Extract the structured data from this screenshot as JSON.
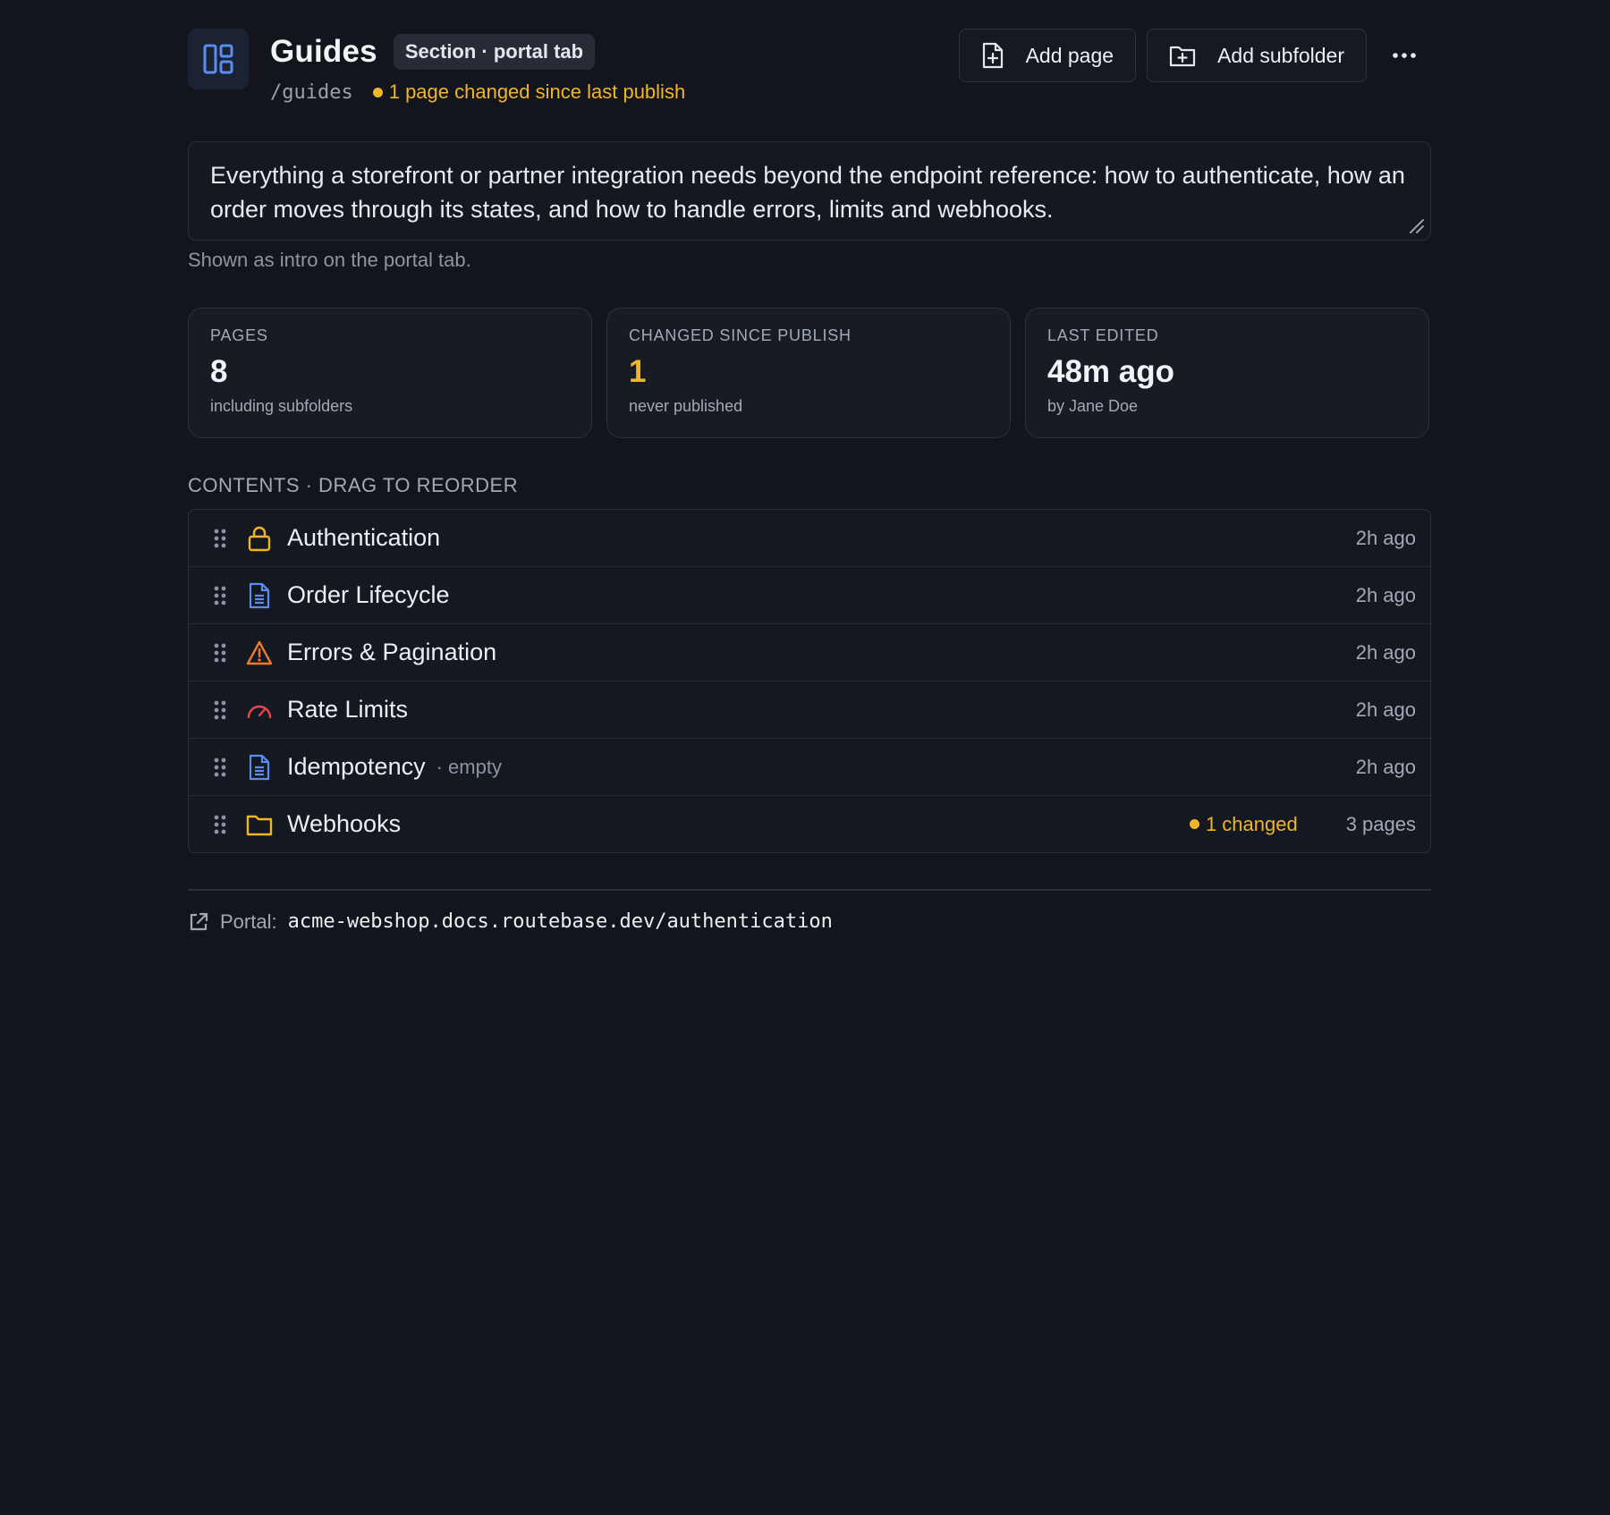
{
  "header": {
    "title": "Guides",
    "badge": "Section · portal tab",
    "path": "/guides",
    "change_note": "1 page changed since last publish",
    "add_page_label": "Add page",
    "add_subfolder_label": "Add subfolder"
  },
  "description": {
    "text": "Everything a storefront or partner integration needs beyond the endpoint reference: how to authenticate, how an order moves through its states, and how to handle errors, limits and webhooks.",
    "hint": "Shown as intro on the portal tab."
  },
  "stats": [
    {
      "label": "PAGES",
      "value": "8",
      "note": "including subfolders"
    },
    {
      "label": "CHANGED SINCE PUBLISH",
      "value": "1",
      "note": "never published"
    },
    {
      "label": "LAST EDITED",
      "value": "48m ago",
      "note": "by Jane Doe"
    }
  ],
  "contents": {
    "label": "CONTENTS · DRAG TO REORDER",
    "items": [
      {
        "title": "Authentication",
        "icon": "lock-icon",
        "time": "2h ago"
      },
      {
        "title": "Order Lifecycle",
        "icon": "document-icon",
        "time": "2h ago"
      },
      {
        "title": "Errors & Pagination",
        "icon": "warning-icon",
        "time": "2h ago"
      },
      {
        "title": "Rate Limits",
        "icon": "gauge-icon",
        "time": "2h ago"
      },
      {
        "title": "Idempotency",
        "icon": "document-icon",
        "extra": "· empty",
        "time": "2h ago"
      },
      {
        "title": "Webhooks",
        "icon": "folder-icon",
        "changed": "1 changed",
        "count": "3 pages"
      }
    ]
  },
  "portal": {
    "label": "Portal:",
    "url": "acme-webshop.docs.routebase.dev/authentication"
  },
  "colors": {
    "background": "#12151c",
    "accent_blue": "#5b8def",
    "warning_yellow": "#f1b628",
    "warning_orange": "#f07a2a",
    "gauge_red": "#e5484d"
  }
}
